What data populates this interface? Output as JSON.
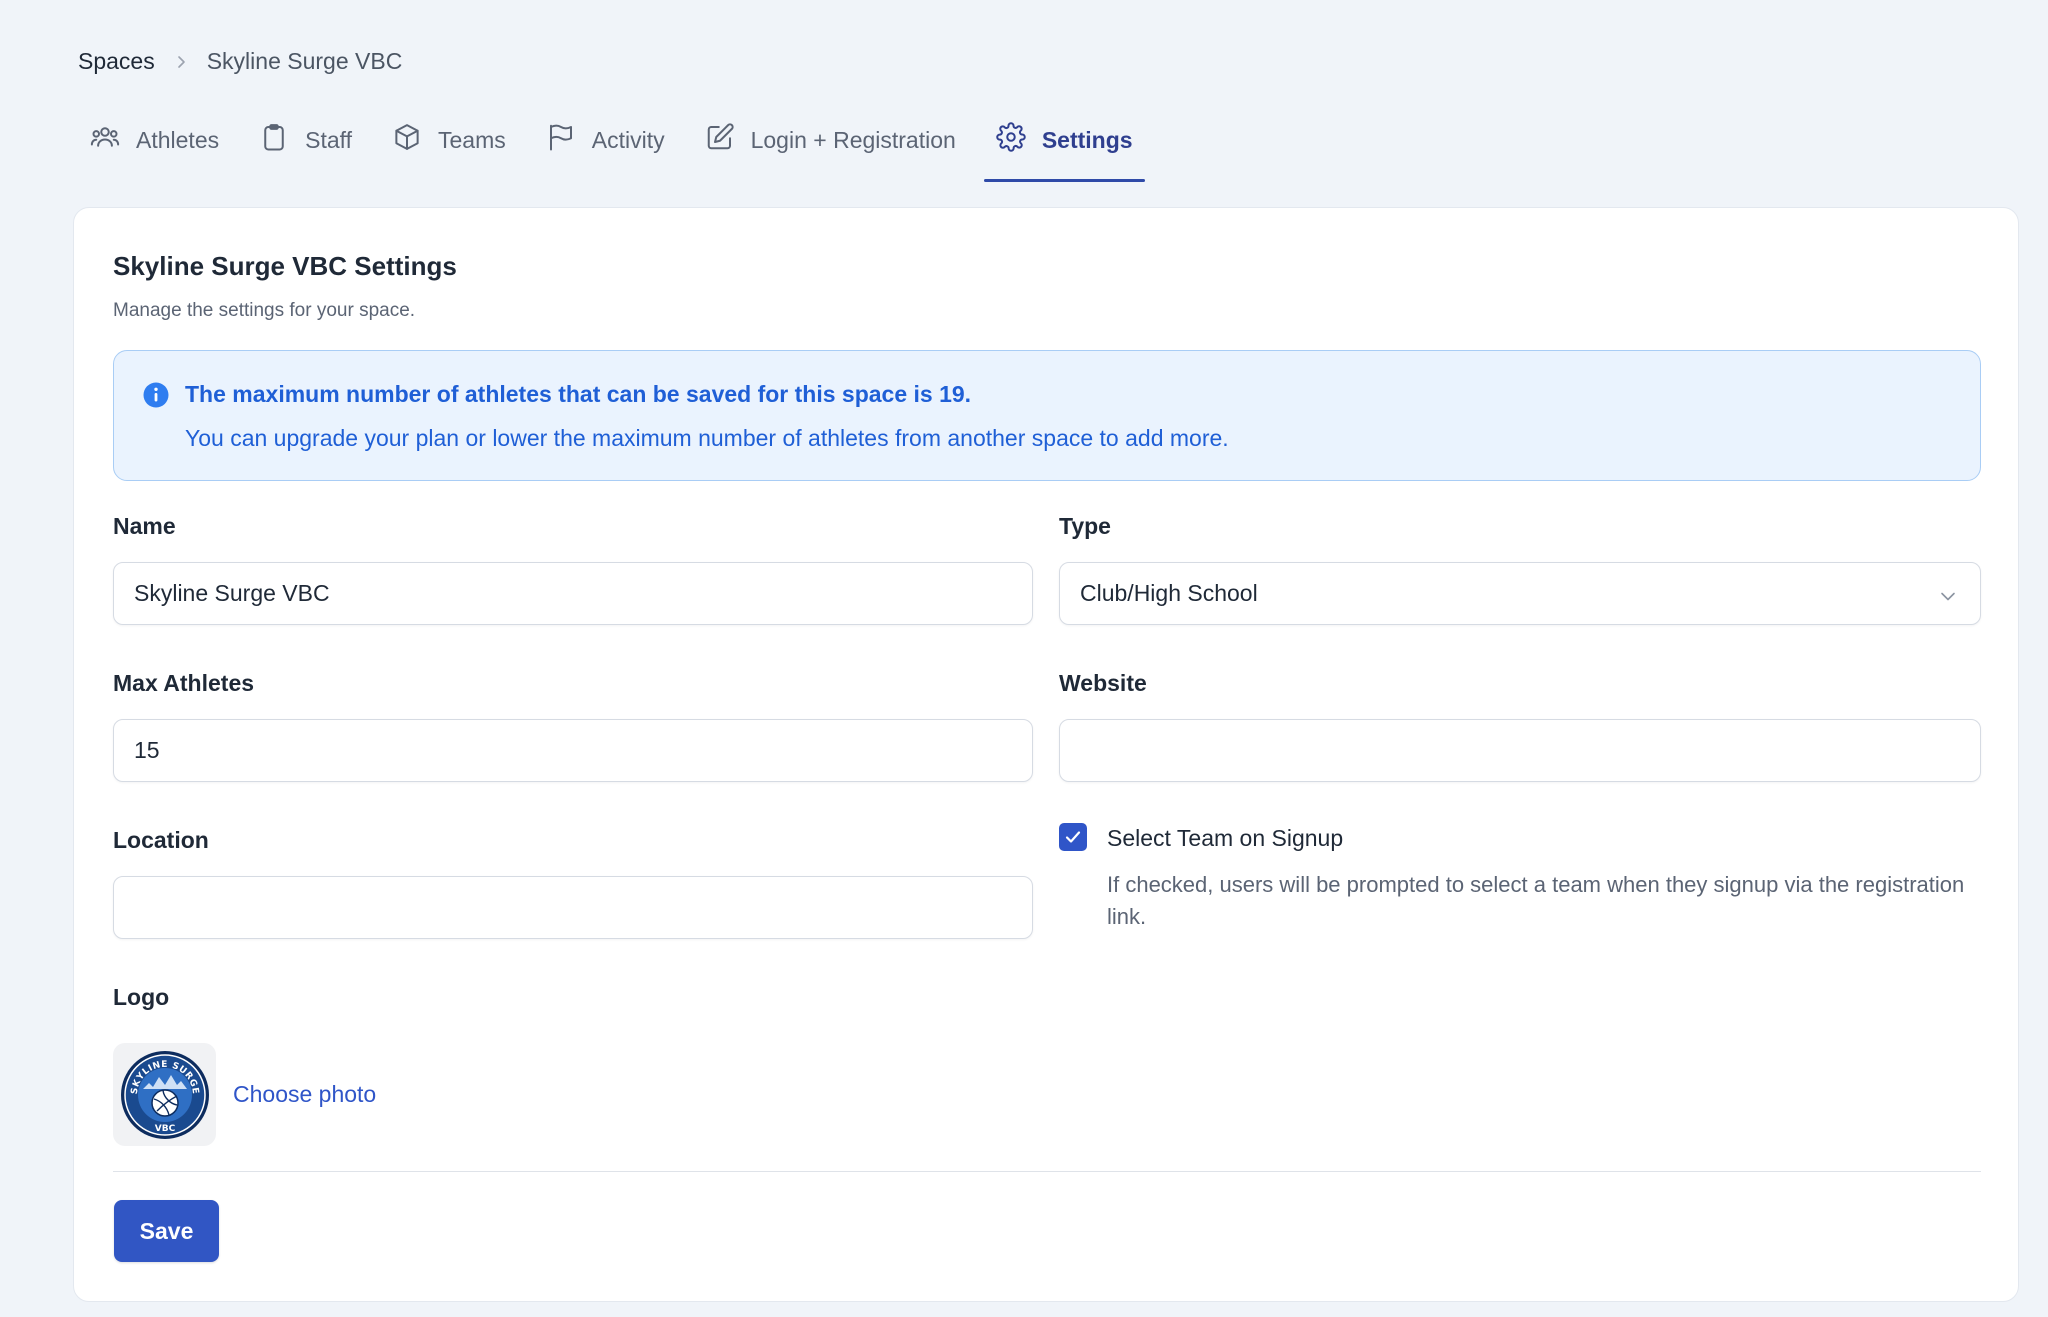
{
  "breadcrumb": {
    "root": "Spaces",
    "current": "Skyline Surge VBC"
  },
  "tabs": [
    {
      "label": "Athletes",
      "icon": "users-icon"
    },
    {
      "label": "Staff",
      "icon": "clipboard-icon"
    },
    {
      "label": "Teams",
      "icon": "cube-icon"
    },
    {
      "label": "Activity",
      "icon": "flag-icon"
    },
    {
      "label": "Login + Registration",
      "icon": "pencil-square-icon"
    },
    {
      "label": "Settings",
      "icon": "gear-icon",
      "active": true
    }
  ],
  "settings": {
    "title": "Skyline Surge VBC Settings",
    "subtitle": "Manage the settings for your space."
  },
  "notice": {
    "line1": "The maximum number of athletes that can be saved for this space is 19.",
    "line2": "You can upgrade your plan or lower the maximum number of athletes from another space to add more.",
    "color": "#1f5fd6"
  },
  "form": {
    "name": {
      "label": "Name",
      "value": "Skyline Surge VBC"
    },
    "type": {
      "label": "Type",
      "value": "Club/High School"
    },
    "max_athletes": {
      "label": "Max Athletes",
      "value": "15"
    },
    "website": {
      "label": "Website",
      "value": ""
    },
    "location": {
      "label": "Location",
      "value": ""
    },
    "select_team": {
      "label": "Select Team on Signup",
      "checked": true,
      "help": "If checked, users will be prompted to select a team when they signup via the registration link."
    },
    "logo": {
      "label": "Logo",
      "choose_label": "Choose photo",
      "logo_text_top": "SKYLINE SURGE",
      "logo_text_bottom": "VBC"
    }
  },
  "actions": {
    "save_label": "Save"
  },
  "colors": {
    "accent": "#3156c4",
    "active_tab": "#2f3f8f",
    "background": "#f0f4f9"
  }
}
